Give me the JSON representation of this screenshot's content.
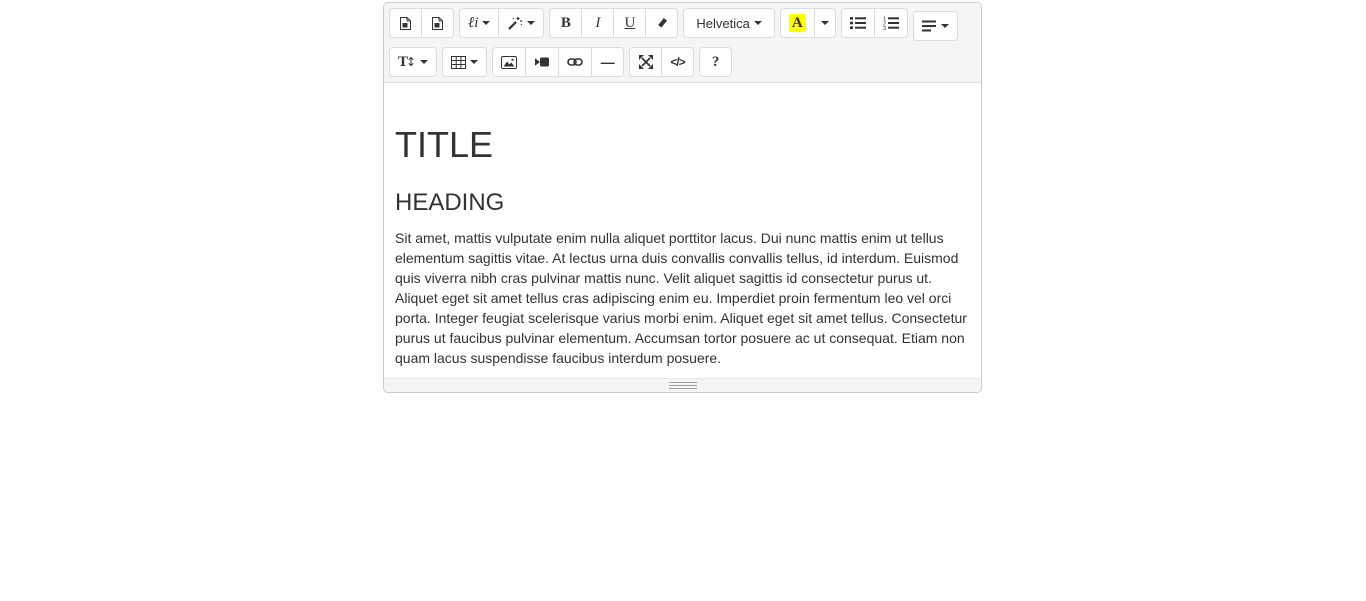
{
  "editor_name": "rich-text-editor",
  "colors": {
    "editor_border": "#cccccc",
    "toolbar_bg": "#f5f5f5",
    "button_bg": "#ffffff",
    "button_border": "#dcdcdc",
    "icon_color": "#333333",
    "highlight_yellow": "#ffff00",
    "statusbar_bg": "#f5f5f5",
    "text_color": "#333333"
  },
  "toolbar": {
    "style_label": "ℓi",
    "bold_label": "B",
    "italic_label": "I",
    "underline_label": "U",
    "fontname_value": "Helvetica",
    "color_label": "A",
    "fontsize_label": "T",
    "fontsize_arrow": "↕",
    "hr_label": "—",
    "codeview_label": "</>",
    "help_label": "?"
  },
  "icons": {
    "document-icon": "file-with-folded-corner",
    "magic-wand-icon": "wand-with-sparkles",
    "eraser-icon": "eraser",
    "caret-down-icon": "small-down-triangle",
    "unordered-list-icon": "bullet-list",
    "ordered-list-icon": "numbered-list",
    "align-left-icon": "paragraph-lines",
    "table-icon": "3x3-grid",
    "picture-icon": "photo-with-mountain",
    "video-icon": "camcorder",
    "link-icon": "chain-links",
    "fullscreen-icon": "diagonal-expand-arrows",
    "resize-handle-icon": "grip-lines"
  },
  "content": {
    "title": "TITLE",
    "heading": "HEADING",
    "paragraph": "Sit amet, mattis vulputate enim nulla aliquet porttitor lacus. Dui nunc mattis enim ut tellus elementum sagittis vitae. At lectus urna duis convallis convallis tellus, id interdum. Euismod quis viverra nibh cras pulvinar mattis nunc. Velit aliquet sagittis id consectetur purus ut. Aliquet eget sit amet tellus cras adipiscing enim eu. Imperdiet proin fermentum leo vel orci porta. Integer feugiat scelerisque varius morbi enim. Aliquet eget sit amet tellus. Consectetur purus ut faucibus pulvinar elementum. Accumsan tortor posuere ac ut consequat. Etiam non quam lacus suspendisse faucibus interdum posuere."
  }
}
